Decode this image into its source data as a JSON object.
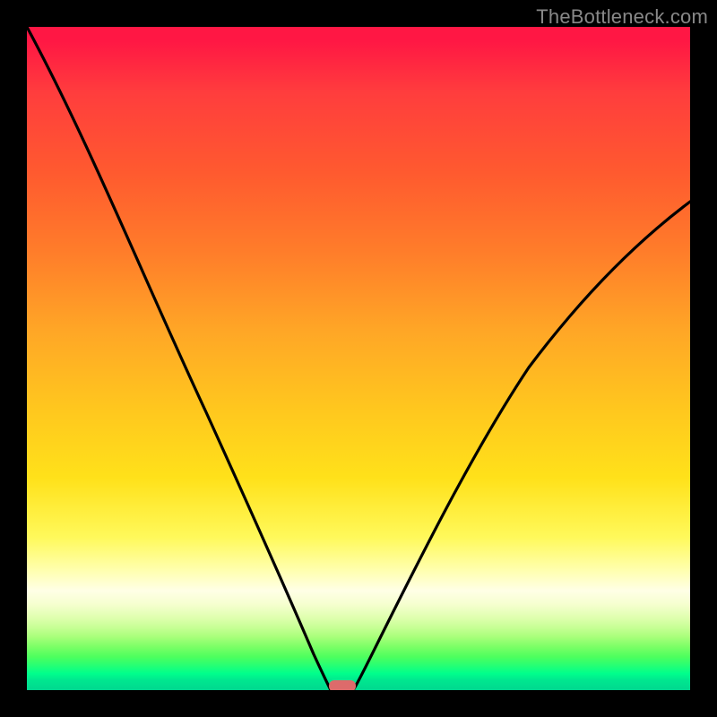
{
  "watermark": "TheBottleneck.com",
  "chart_data": {
    "type": "line",
    "title": "",
    "xlabel": "",
    "ylabel": "",
    "xlim": [
      0,
      100
    ],
    "ylim": [
      0,
      100
    ],
    "background_gradient": {
      "top": "#ff1744",
      "middle": "#ffe11a",
      "bottom": "#00d88f"
    },
    "series": [
      {
        "name": "left-curve",
        "x": [
          0,
          4,
          10,
          16,
          22,
          28,
          33,
          38,
          42,
          44.5,
          45.8
        ],
        "y": [
          100,
          82,
          62,
          45,
          31,
          20,
          12,
          6,
          2,
          0.3,
          0
        ]
      },
      {
        "name": "right-curve",
        "x": [
          49.2,
          51,
          54,
          58,
          63,
          69,
          76,
          84,
          92,
          100
        ],
        "y": [
          0,
          1.5,
          6,
          13,
          23,
          34,
          46,
          57,
          66,
          74
        ]
      }
    ],
    "marker": {
      "name": "minimum-marker",
      "cx": 47.5,
      "width": 4.0,
      "color": "#e06666"
    }
  }
}
